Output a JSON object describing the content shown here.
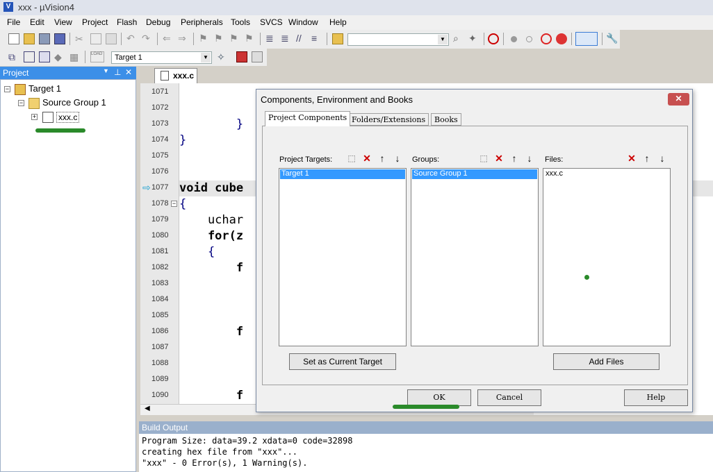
{
  "window": {
    "title": "xxx - µVision4",
    "app_icon_letter": "V"
  },
  "menu": [
    "File",
    "Edit",
    "View",
    "Project",
    "Flash",
    "Debug",
    "Peripherals",
    "Tools",
    "SVCS",
    "Window",
    "Help"
  ],
  "toolbar2": {
    "load_label": "LOAD",
    "target_select": "Target 1"
  },
  "project_pane": {
    "title": "Project",
    "tree": {
      "root": "Target 1",
      "group": "Source Group 1",
      "file": "xxx.c"
    }
  },
  "editor": {
    "tab": "xxx.c",
    "lines": [
      {
        "n": "1071",
        "code": ""
      },
      {
        "n": "1072",
        "code": ""
      },
      {
        "n": "1073",
        "code": "        }"
      },
      {
        "n": "1074",
        "code": "}"
      },
      {
        "n": "1075",
        "code": ""
      },
      {
        "n": "1076",
        "code": ""
      },
      {
        "n": "1077",
        "code": "void cube"
      },
      {
        "n": "1078",
        "code": "{"
      },
      {
        "n": "1079",
        "code": "    uchar"
      },
      {
        "n": "1080",
        "code": "    for(z"
      },
      {
        "n": "1081",
        "code": "    {"
      },
      {
        "n": "1082",
        "code": "        f"
      },
      {
        "n": "1083",
        "code": ""
      },
      {
        "n": "1084",
        "code": ""
      },
      {
        "n": "1085",
        "code": ""
      },
      {
        "n": "1086",
        "code": "        f"
      },
      {
        "n": "1087",
        "code": ""
      },
      {
        "n": "1088",
        "code": ""
      },
      {
        "n": "1089",
        "code": ""
      },
      {
        "n": "1090",
        "code": "        f"
      }
    ]
  },
  "build_output": {
    "title": "Build Output",
    "lines": [
      "Program Size: data=39.2 xdata=0 code=32898",
      "creating hex file from \"xxx\"...",
      "\"xxx\" - 0 Error(s), 1 Warning(s)."
    ]
  },
  "dialog": {
    "title": "Components, Environment and Books",
    "close_glyph": "✕",
    "tabs": [
      "Project Components",
      "Folders/Extensions",
      "Books"
    ],
    "targets": {
      "label": "Project Targets:",
      "items": [
        "Target 1"
      ]
    },
    "groups": {
      "label": "Groups:",
      "items": [
        "Source Group 1"
      ]
    },
    "files": {
      "label": "Files:",
      "items": [
        "xxx.c"
      ]
    },
    "set_current_target": "Set as Current Target",
    "add_files": "Add Files",
    "ok": "OK",
    "cancel": "Cancel",
    "help": "Help"
  }
}
